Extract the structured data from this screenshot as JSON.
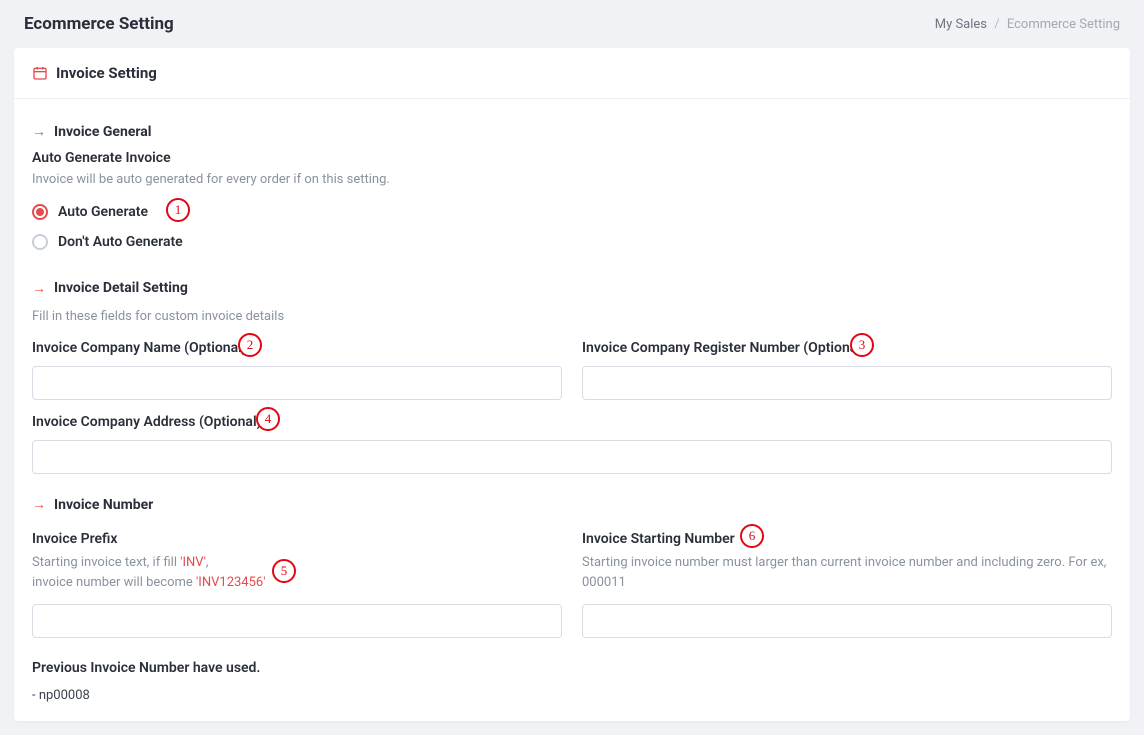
{
  "header": {
    "title": "Ecommerce Setting"
  },
  "breadcrumb": {
    "parent": "My Sales",
    "current": "Ecommerce Setting",
    "sep": "/"
  },
  "card": {
    "title": "Invoice Setting"
  },
  "sections": {
    "general": {
      "title": "Invoice General",
      "auto_label": "Auto Generate Invoice",
      "auto_help": "Invoice will be auto generated for every order if on this setting.",
      "radio_auto": "Auto Generate",
      "radio_dont": "Don't Auto Generate"
    },
    "detail": {
      "title": "Invoice Detail Setting",
      "help": "Fill in these fields for custom invoice details",
      "company_name_label": "Invoice Company Name (Optional)",
      "company_reg_label": "Invoice Company Register Number (Optional)",
      "company_addr_label": "Invoice Company Address (Optional)"
    },
    "number": {
      "title": "Invoice Number",
      "prefix_label": "Invoice Prefix",
      "prefix_help_1": "Starting invoice text, if fill ",
      "prefix_help_inv": "'INV'",
      "prefix_help_2": ",",
      "prefix_help_3": "invoice number will become ",
      "prefix_help_inv2": "'INV123456'",
      "start_label": "Invoice Starting Number",
      "start_help": "Starting invoice number must larger than current invoice number and including zero. For ex, 000011",
      "prev_label": "Previous Invoice Number have used.",
      "prev_item": "- np00008"
    }
  },
  "annotations": {
    "a1": "1",
    "a2": "2",
    "a3": "3",
    "a4": "4",
    "a5": "5",
    "a6": "6"
  }
}
